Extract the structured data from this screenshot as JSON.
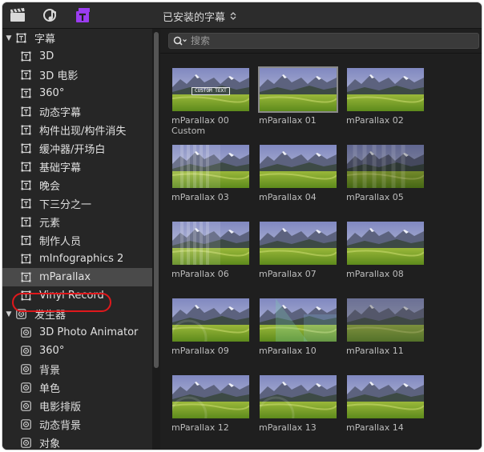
{
  "toolbar": {
    "icons": [
      "clapperboard-icon",
      "music-icon",
      "titles-icon"
    ],
    "library_title": "已安装的字幕"
  },
  "sidebar": {
    "groups": [
      {
        "label": "字幕",
        "expanded": true,
        "items": [
          "3D",
          "3D 电影",
          "360°",
          "动态字幕",
          "构件出现/构件消失",
          "缓冲器/开场白",
          "基础字幕",
          "晚会",
          "下三分之一",
          "元素",
          "制作人员",
          "mInfographics 2",
          "mParallax",
          "Vinyl Record"
        ]
      },
      {
        "label": "发生器",
        "expanded": true,
        "items": [
          "3D Photo Animator",
          "360°",
          "背景",
          "单色",
          "电影排版",
          "动态背景",
          "对象"
        ]
      }
    ],
    "selected_item": "mParallax"
  },
  "search": {
    "placeholder": "搜索",
    "value": ""
  },
  "tiles": [
    {
      "label": "mParallax 00",
      "sublabel": "Custom",
      "overlay_text": "CUSTOM TEXT"
    },
    {
      "label": "mParallax 01",
      "selected": true
    },
    {
      "label": "mParallax 02"
    },
    {
      "label": "mParallax 03"
    },
    {
      "label": "mParallax 04"
    },
    {
      "label": "mParallax 05"
    },
    {
      "label": "mParallax 06"
    },
    {
      "label": "mParallax 07"
    },
    {
      "label": "mParallax 08"
    },
    {
      "label": "mParallax 09"
    },
    {
      "label": "mParallax 10"
    },
    {
      "label": "mParallax 11"
    },
    {
      "label": "mParallax 12"
    },
    {
      "label": "mParallax 13"
    },
    {
      "label": "mParallax 14"
    }
  ],
  "colors": {
    "accent_purple": "#9b3cf0",
    "highlight_red": "#e0181c",
    "sky": "#5a66a8",
    "grass": "#7ea62c"
  }
}
